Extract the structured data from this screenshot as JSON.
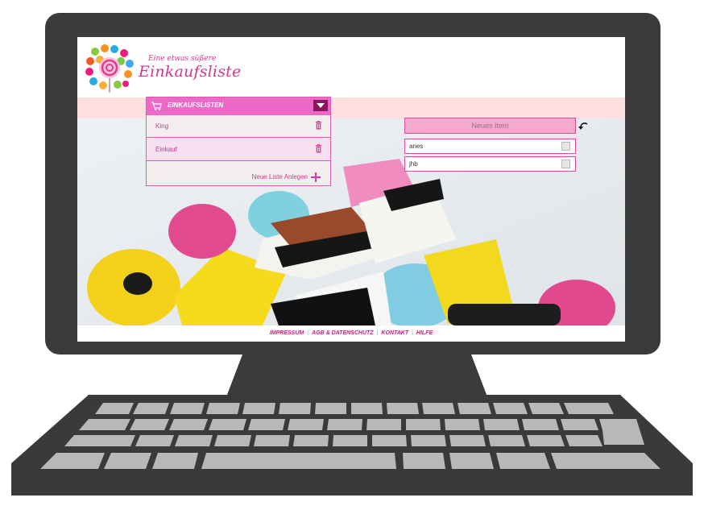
{
  "app": {
    "tagline": "Eine etwas süßere",
    "brand": "Einkaufsliste"
  },
  "lists_panel": {
    "title": "EINKAUFSLISTEN",
    "lists": [
      {
        "name": "King"
      },
      {
        "name": "Einkauf"
      }
    ],
    "new_list_label": "Neue Liste Anlegen"
  },
  "items_panel": {
    "new_item_placeholder": "Neues Item",
    "items": [
      {
        "name": "anes",
        "checked": false
      },
      {
        "name": "jhb",
        "checked": false
      }
    ]
  },
  "footer": {
    "links": [
      "IMPRESSUM",
      "AGB & DATENSCHUTZ",
      "KONTAKT",
      "HILFE"
    ]
  },
  "colors": {
    "accent": "#ee68c7",
    "brand_text": "#d6358d",
    "header_band": "#fde0df",
    "monitor": "#3b3b3b"
  }
}
